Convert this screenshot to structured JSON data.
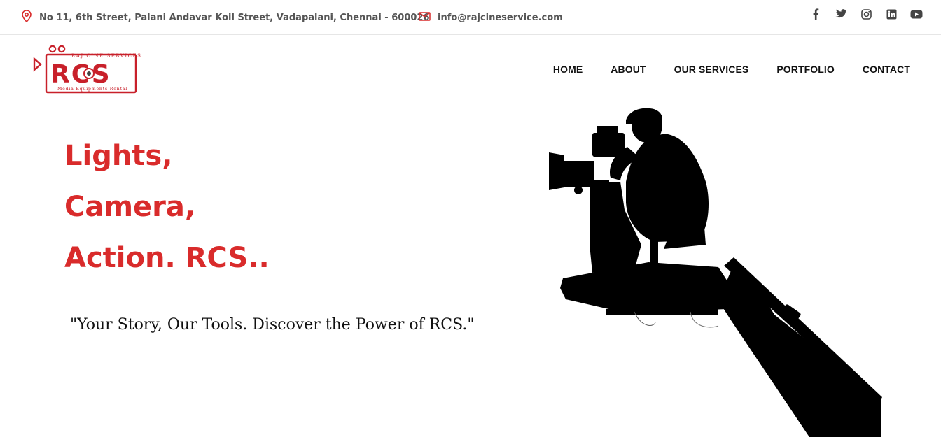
{
  "topbar": {
    "address": "No 11, 6th Street, Palani Andavar Koil Street, Vadapalani, Chennai - 600026",
    "email": "info@rajcineservice.com",
    "social": [
      "facebook-icon",
      "twitter-icon",
      "instagram-icon",
      "linkedin-icon",
      "youtube-icon"
    ]
  },
  "logo": {
    "top_text": "RAJ CINE SERVICES",
    "main_text": "RCS",
    "bottom_text": "Media Equipments Rental"
  },
  "nav": {
    "items": [
      "HOME",
      "ABOUT",
      "OUR SERVICES",
      "PORTFOLIO",
      "CONTACT"
    ]
  },
  "hero": {
    "line1": "Lights,",
    "line2": "Camera,",
    "line3": "Action. RCS..",
    "tagline": "\"Your Story, Our Tools. Discover the Power of RCS.\""
  },
  "colors": {
    "accent": "#d92b2b",
    "text": "#111111",
    "muted": "#555555"
  }
}
